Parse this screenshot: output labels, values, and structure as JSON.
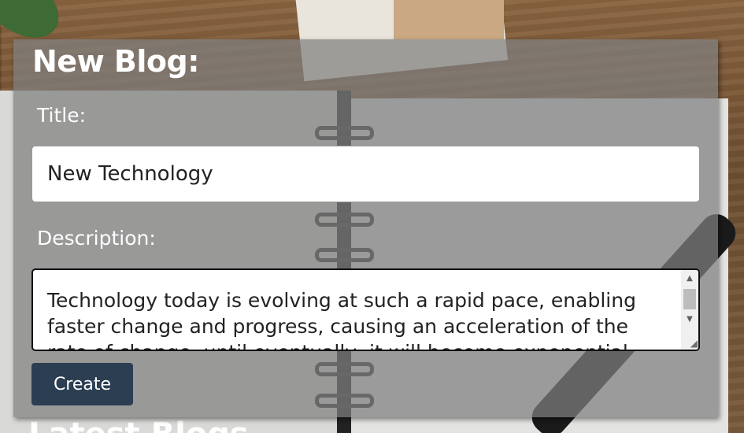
{
  "form": {
    "heading": "New Blog:",
    "title_label": "Title:",
    "title_value": "New Technology",
    "description_label": "Description:",
    "description_value": "Technology today is evolving at such a rapid pace, enabling faster change and progress, causing an acceleration of the rate of change, until eventually, it will become exponential.",
    "create_label": "Create"
  },
  "background": {
    "heading_peek": "Latest Blogs"
  },
  "colors": {
    "button": "#2b3e52",
    "card_overlay": "rgba(128,128,128,0.72)"
  },
  "icons": {
    "scroll_up": "triangle-up",
    "scroll_down": "triangle-down",
    "resize": "resize-grip"
  }
}
